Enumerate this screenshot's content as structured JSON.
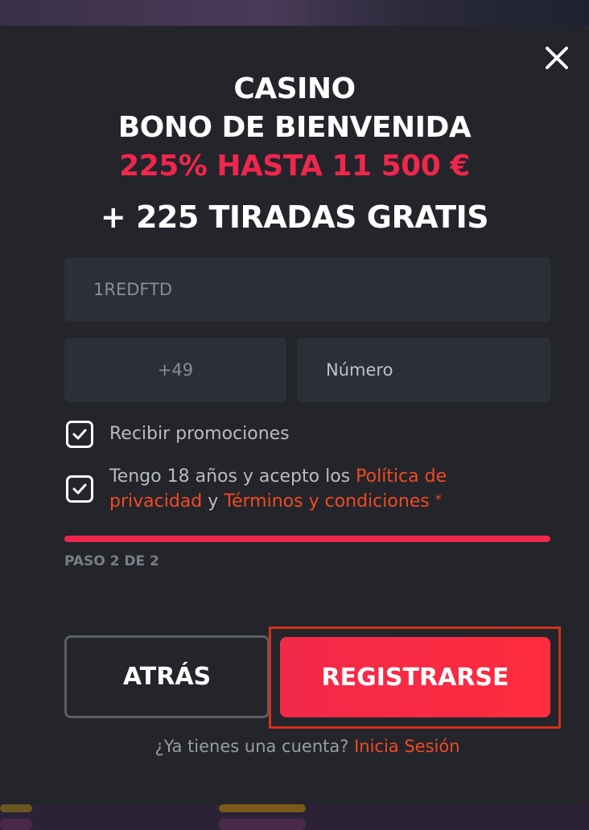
{
  "headline": {
    "line1": "CASINO",
    "line2": "BONO DE BIENVENIDA",
    "line3": "225% HASTA 11 500 €",
    "line4": "+ 225 TIRADAS GRATIS"
  },
  "form": {
    "promo_code_value": "1REDFTD",
    "phone_code_value": "+49",
    "phone_number_placeholder": "Número"
  },
  "checkboxes": {
    "promotions": {
      "checked": true,
      "label": "Recibir promociones"
    },
    "terms": {
      "checked": true,
      "label_prefix": "Tengo 18 años y acepto los",
      "privacy_link": "Política de privacidad",
      "conjunction": "y",
      "terms_link": "Términos y condiciones",
      "required_marker": "*"
    }
  },
  "progress": {
    "fraction": 1.0,
    "step_label": "PASO 2 DE 2"
  },
  "buttons": {
    "back_label": "ATRÁS",
    "register_label": "REGISTRARSE"
  },
  "footer": {
    "question": "¿Ya tienes una cuenta?",
    "login_link": "Inicia Sesión"
  },
  "colors": {
    "accent": "#f0264c",
    "link": "#f04a22",
    "modal_bg": "#23252b",
    "field_bg": "#2c2f38"
  },
  "icons": {
    "close": "close-icon",
    "check": "check-icon"
  }
}
